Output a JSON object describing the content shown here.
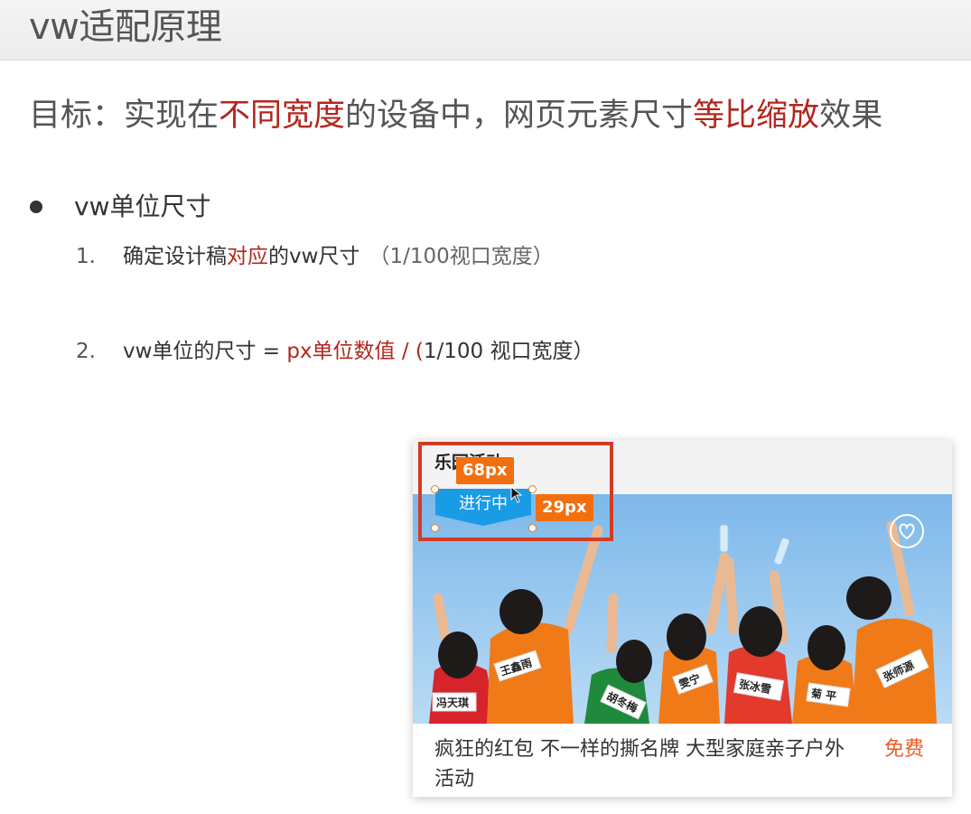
{
  "slide": {
    "title": "vw适配原理",
    "goal": {
      "prefix": "目标：实现在",
      "highlight1": "不同宽度",
      "middle": "的设备中，网页元素尺寸",
      "highlight2": "等比缩放",
      "suffix": "效果"
    }
  },
  "bullet": {
    "label": "vw单位尺寸",
    "steps": [
      {
        "num": "1.",
        "pre": "确定设计稿",
        "highlight": "对应",
        "post": "的vw尺寸",
        "note": "（1/100视口宽度）"
      },
      {
        "num": "2.",
        "pre": "vw单位的尺寸 =",
        "highlight": "px单位数值 / (",
        "post": "1/100 视口宽度）"
      }
    ]
  },
  "card": {
    "title": "乐园活动",
    "badge": "进行中",
    "width_tag": "68px",
    "height_tag": "29px",
    "description": "疯狂的红包 不一样的撕名牌 大型家庭亲子户外活动",
    "price": "免费",
    "name_tags": [
      "冯天琪",
      "王鑫雨",
      "胡冬梅",
      "雯宁",
      "张冰雪",
      "菊 平",
      "张师源"
    ]
  },
  "colors": {
    "highlight_red": "#b3261e",
    "badge_blue": "#1a9be6",
    "tag_orange": "#f26f0f",
    "price_orange": "#f05a24",
    "annotation_red": "#d43b24",
    "sky": "#8ec3ec"
  },
  "icons": {
    "heart": "heart-icon",
    "cursor": "mouse-cursor-icon"
  }
}
